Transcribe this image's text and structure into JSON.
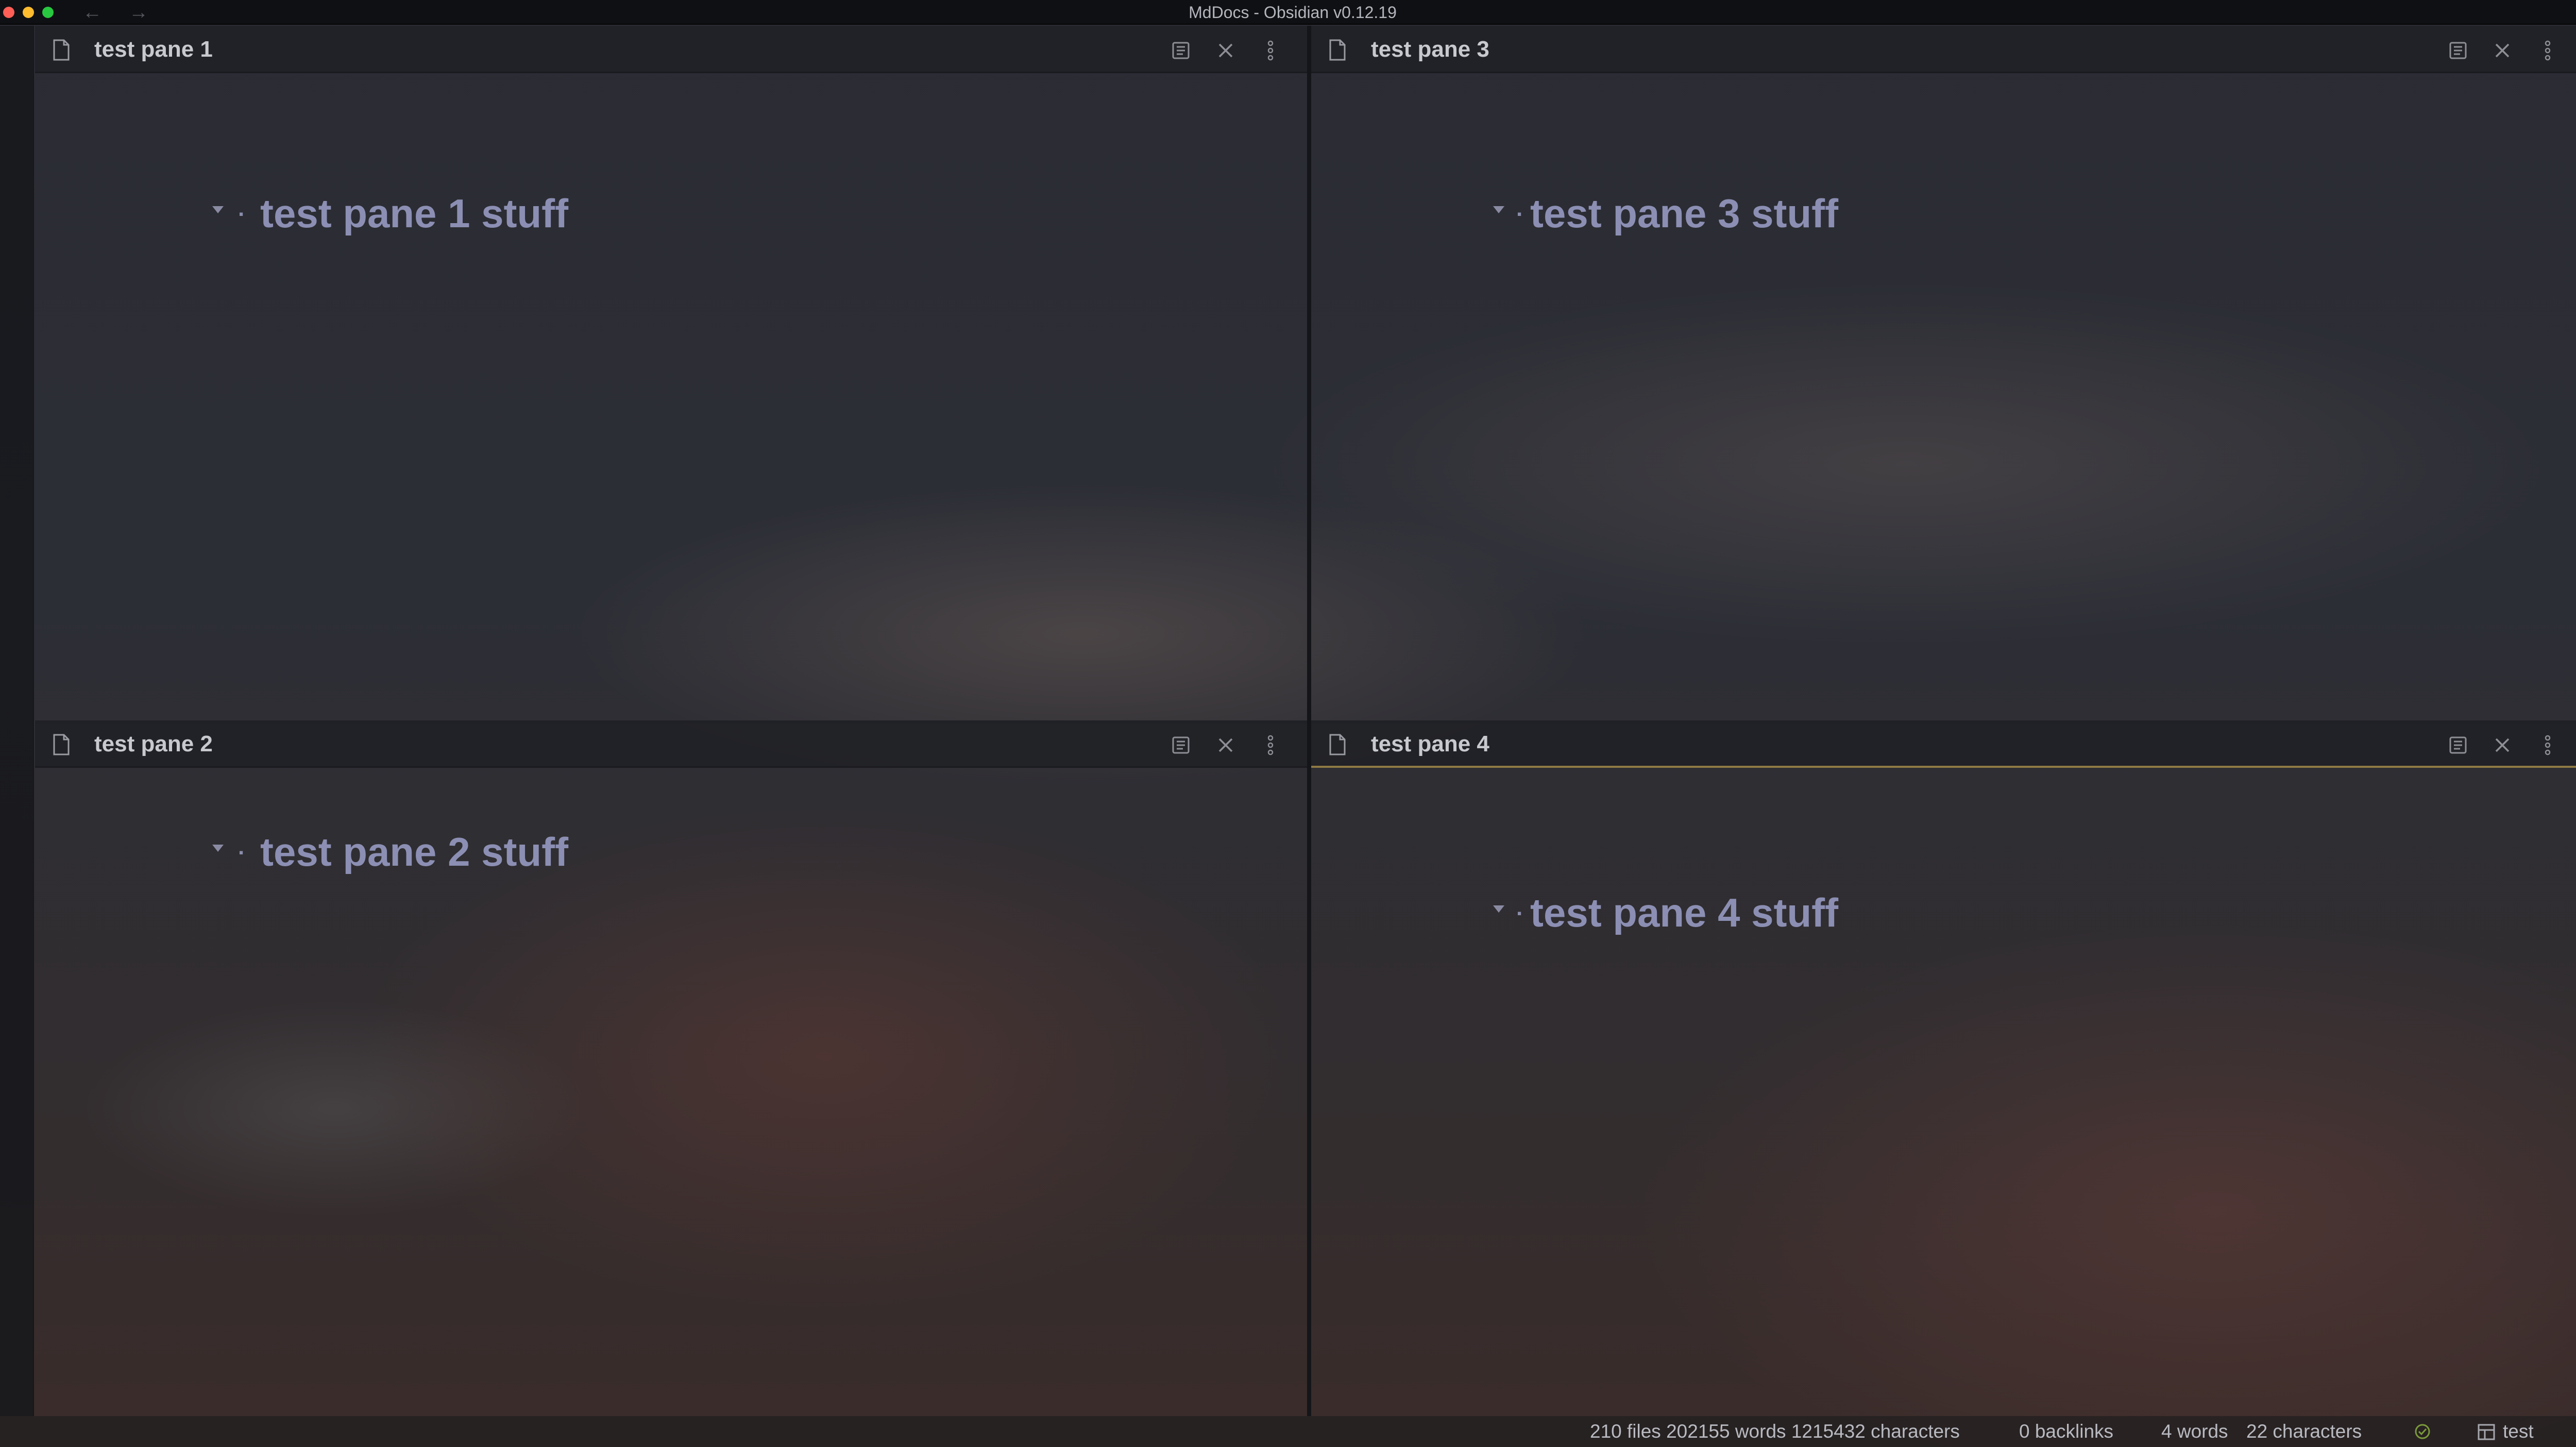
{
  "window": {
    "title": "MdDocs - Obsidian v0.12.19",
    "back_arrow": "←",
    "forward_arrow": "→"
  },
  "panes": [
    {
      "id": "pane1",
      "title": "test pane 1",
      "bullet": ".",
      "heading": "test pane 1 stuff",
      "active": false
    },
    {
      "id": "pane2",
      "title": "test pane 2",
      "bullet": ".",
      "heading": "test pane 2 stuff",
      "active": false
    },
    {
      "id": "pane3",
      "title": "test pane 3",
      "bullet": ".",
      "heading": "test pane 3 stuff",
      "active": false
    },
    {
      "id": "pane4",
      "title": "test pane 4",
      "bullet": ".",
      "heading": "test pane 4 stuff",
      "active": true
    }
  ],
  "header_icons": [
    "reading-view-icon",
    "close-icon",
    "more-options-icon"
  ],
  "statusbar": {
    "vault_stats": "210 files 202155 words 1215432 characters",
    "backlinks": "0 backlinks",
    "word_count": "4 words",
    "char_count": "22 characters",
    "sync_icon": "check-circle-icon",
    "workspace_icon": "layout-icon",
    "workspace": "test"
  },
  "colors": {
    "heading": "#8c8fb3",
    "active_tab_border": "#8f7a43",
    "sync_ok": "#7a9a3a"
  }
}
